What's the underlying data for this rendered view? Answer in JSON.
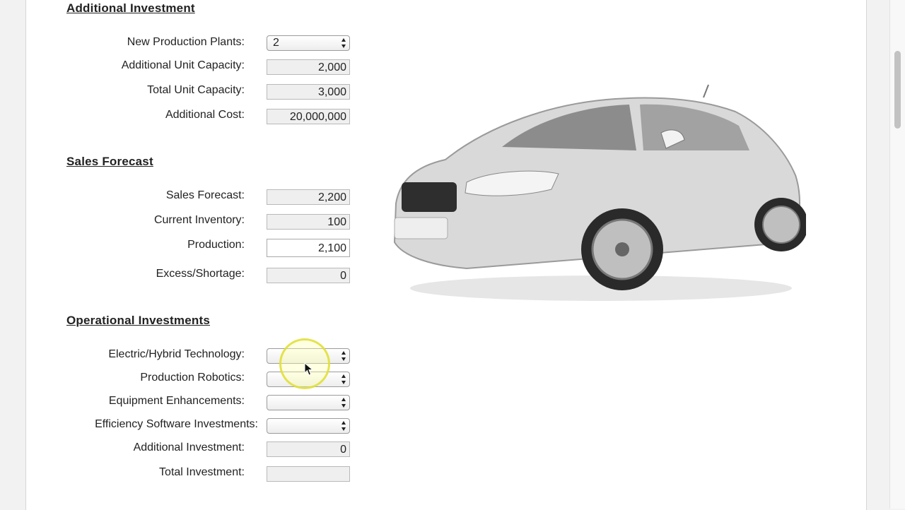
{
  "additional_investment": {
    "title": "Additional Investment",
    "new_production_plants": {
      "label": "New Production Plants:",
      "value": "2"
    },
    "additional_unit_capacity": {
      "label": "Additional Unit Capacity:",
      "value": "2,000"
    },
    "total_unit_capacity": {
      "label": "Total Unit Capacity:",
      "value": "3,000"
    },
    "additional_cost": {
      "label": "Additional Cost:",
      "value": "20,000,000"
    }
  },
  "sales_forecast": {
    "title": "Sales Forecast",
    "sales_forecast": {
      "label": "Sales Forecast:",
      "value": "2,200"
    },
    "current_inventory": {
      "label": "Current Inventory:",
      "value": "100"
    },
    "production": {
      "label": "Production:",
      "value": "2,100"
    },
    "excess_shortage": {
      "label": "Excess/Shortage:",
      "value": "0"
    }
  },
  "operational_investments": {
    "title": "Operational Investments",
    "electric_hybrid": {
      "label": "Electric/Hybrid Technology:",
      "value": ""
    },
    "production_robotics": {
      "label": "Production Robotics:",
      "value": ""
    },
    "equipment_enhancements": {
      "label": "Equipment Enhancements:",
      "value": ""
    },
    "efficiency_software": {
      "label": "Efficiency Software Investments:",
      "value": ""
    },
    "additional_investment": {
      "label": "Additional Investment:",
      "value": "0"
    },
    "total_investment": {
      "label": "Total Investment:",
      "value": ""
    }
  },
  "image": {
    "subject": "silver-hatchback-car"
  },
  "colors": {
    "section_title": "#222222",
    "readonly_field": "#efefef",
    "cursor_highlight": "#e6e640"
  }
}
